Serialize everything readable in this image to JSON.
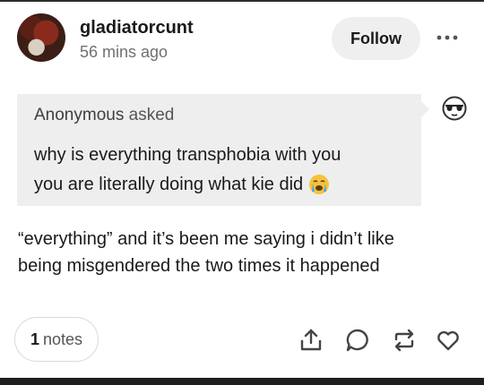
{
  "post": {
    "username": "gladiatorcunt",
    "time": "56 mins ago",
    "follow_label": "Follow"
  },
  "ask": {
    "asker": "Anonymous",
    "asked_word": "asked",
    "line1": "why is everything transphobia with you",
    "line2": "you are literally doing what kie did",
    "emoji": "😭"
  },
  "answer": {
    "line1": "“everything” and it’s been me saying i didn’t like",
    "line2": "being misgendered the two times it happened"
  },
  "footer": {
    "notes_count": "1",
    "notes_label": "notes"
  },
  "icons": [
    "more-icon",
    "sunglasses-avatar-icon",
    "share-icon",
    "reply-icon",
    "reblog-icon",
    "like-icon"
  ]
}
